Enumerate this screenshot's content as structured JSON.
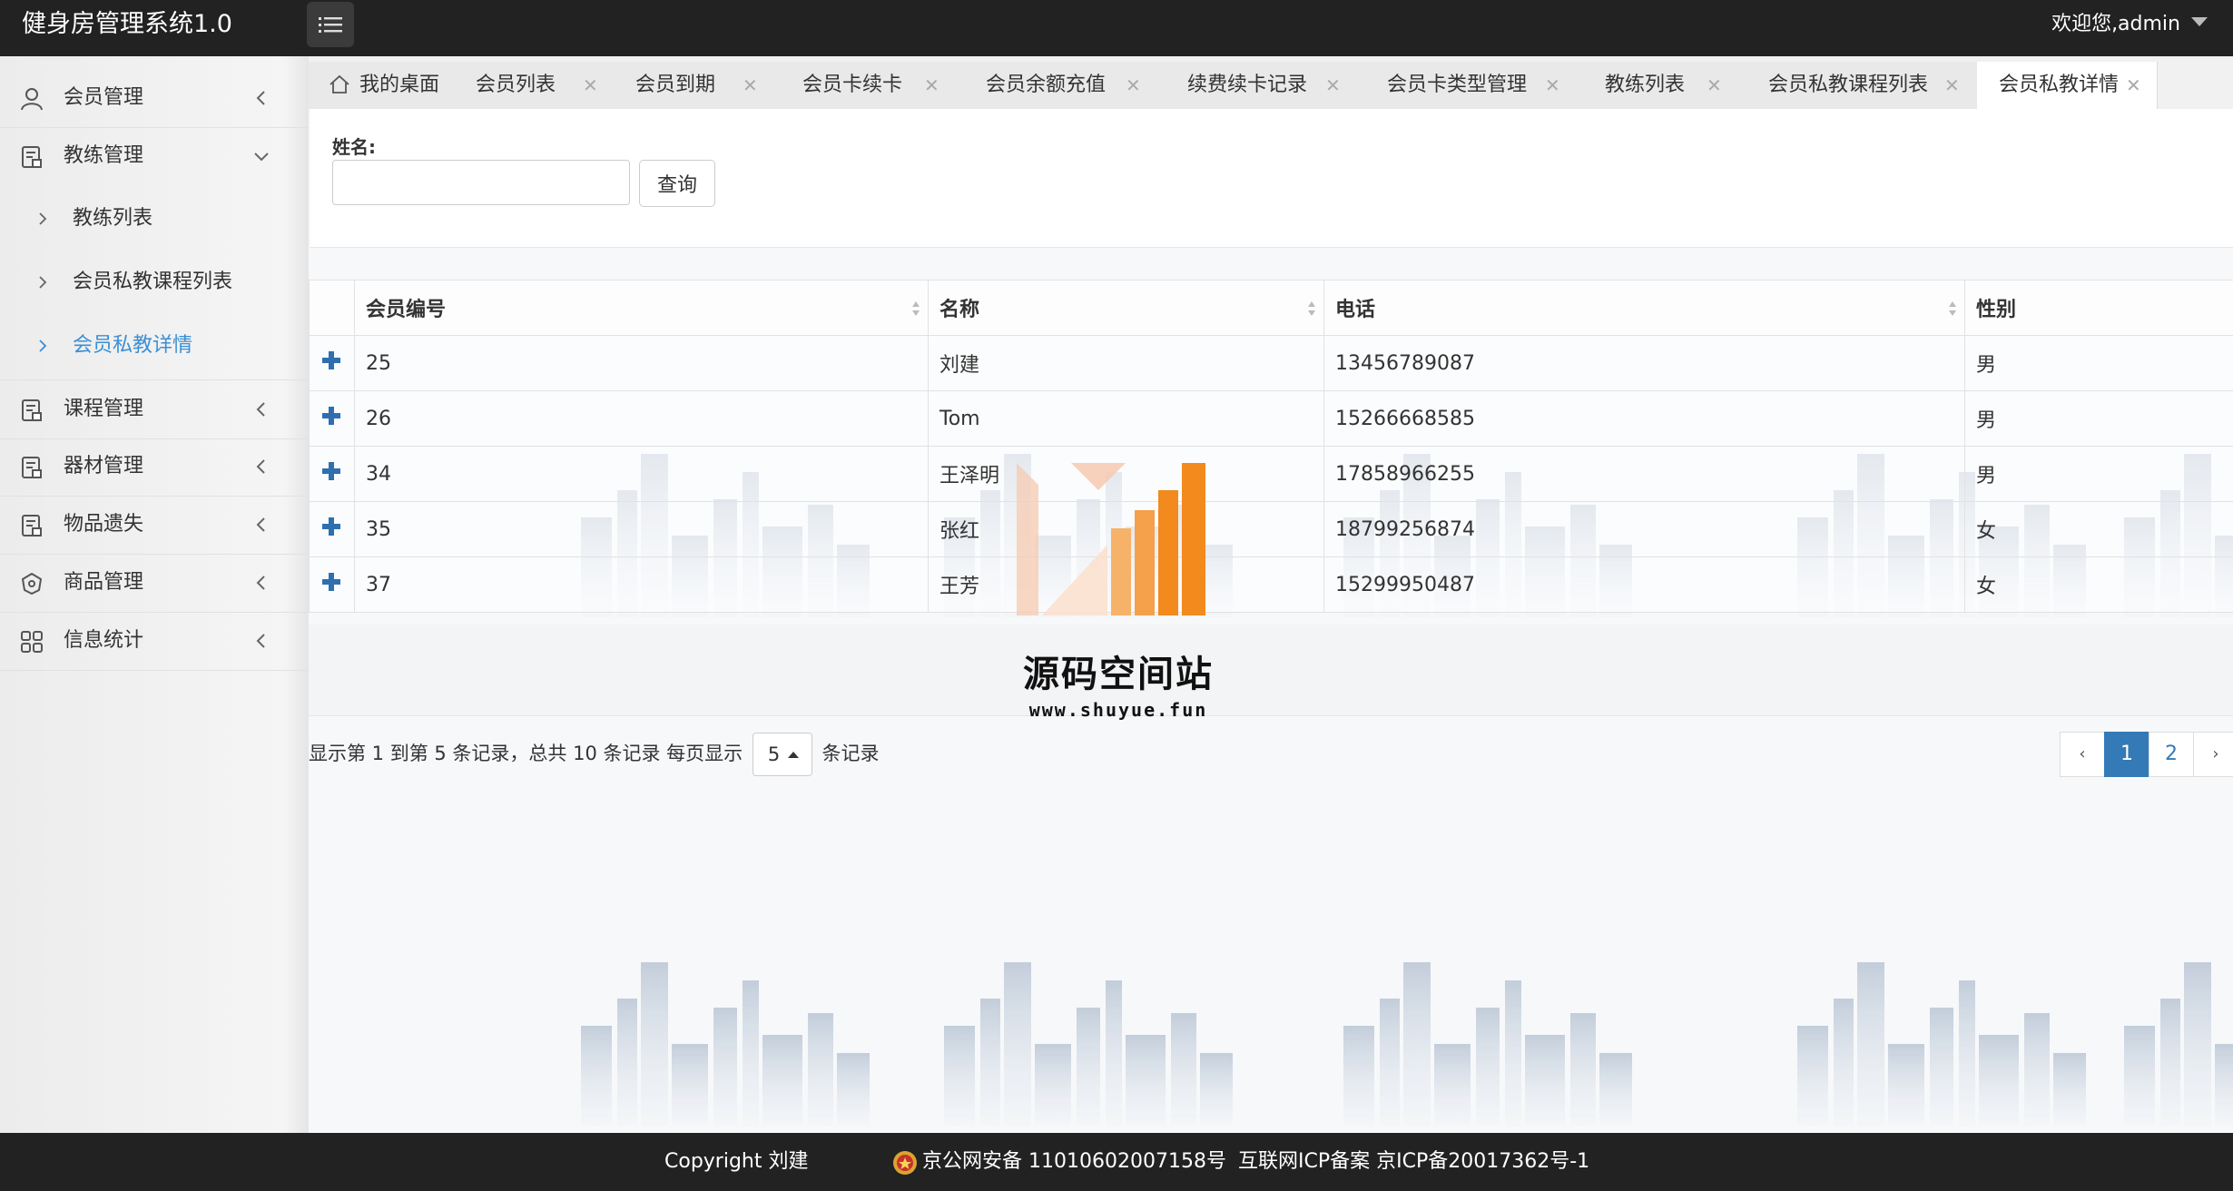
{
  "header": {
    "app_title": "健身房管理系统1.0",
    "welcome": "欢迎您,admin"
  },
  "sidebar": {
    "items": [
      {
        "label": "会员管理",
        "icon": "user-icon"
      },
      {
        "label": "教练管理",
        "icon": "document-icon"
      },
      {
        "label": "课程管理",
        "icon": "document-icon"
      },
      {
        "label": "器材管理",
        "icon": "document-icon"
      },
      {
        "label": "物品遗失",
        "icon": "document-icon"
      },
      {
        "label": "商品管理",
        "icon": "package-icon"
      },
      {
        "label": "信息统计",
        "icon": "grid-icon"
      }
    ],
    "subitems": [
      {
        "label": "教练列表"
      },
      {
        "label": "会员私教课程列表"
      },
      {
        "label": "会员私教详情",
        "active": true
      }
    ]
  },
  "tabs": [
    {
      "label": "我的桌面"
    },
    {
      "label": "会员列表"
    },
    {
      "label": "会员到期"
    },
    {
      "label": "会员卡续卡"
    },
    {
      "label": "会员余额充值"
    },
    {
      "label": "续费续卡记录"
    },
    {
      "label": "会员卡类型管理"
    },
    {
      "label": "教练列表"
    },
    {
      "label": "会员私教课程列表"
    },
    {
      "label": "会员私教详情",
      "active": true
    }
  ],
  "search": {
    "label": "姓名:",
    "value": "",
    "button": "查询"
  },
  "table": {
    "columns": [
      "会员编号",
      "名称",
      "电话",
      "性别"
    ],
    "rows": [
      [
        "25",
        "刘建",
        "13456789087",
        "男"
      ],
      [
        "26",
        "Tom",
        "15266668585",
        "男"
      ],
      [
        "34",
        "王泽明",
        "17858966255",
        "男"
      ],
      [
        "35",
        "张红",
        "18799256874",
        "女"
      ],
      [
        "37",
        "王芳",
        "15299950487",
        "女"
      ]
    ]
  },
  "pager": {
    "info_prefix": "显示第 1 到第 5 条记录，总共 10 条记录 每页显示",
    "page_size": "5",
    "info_suffix": "条记录",
    "prev": "‹",
    "pages": [
      "1",
      "2"
    ],
    "next": "›",
    "current": "1"
  },
  "watermark": {
    "title": "源码空间站",
    "url": "www.shuyue.fun"
  },
  "footer": {
    "copyright": "Copyright 刘建",
    "gongan": "京公网安备 11010602007158号",
    "icp": "互联网ICP备案 京ICP备20017362号-1"
  },
  "colors": {
    "topbar": "#222222",
    "accent": "#337ab7",
    "active_link": "#3b8fd4",
    "logo_orange": "#f28a1d"
  }
}
